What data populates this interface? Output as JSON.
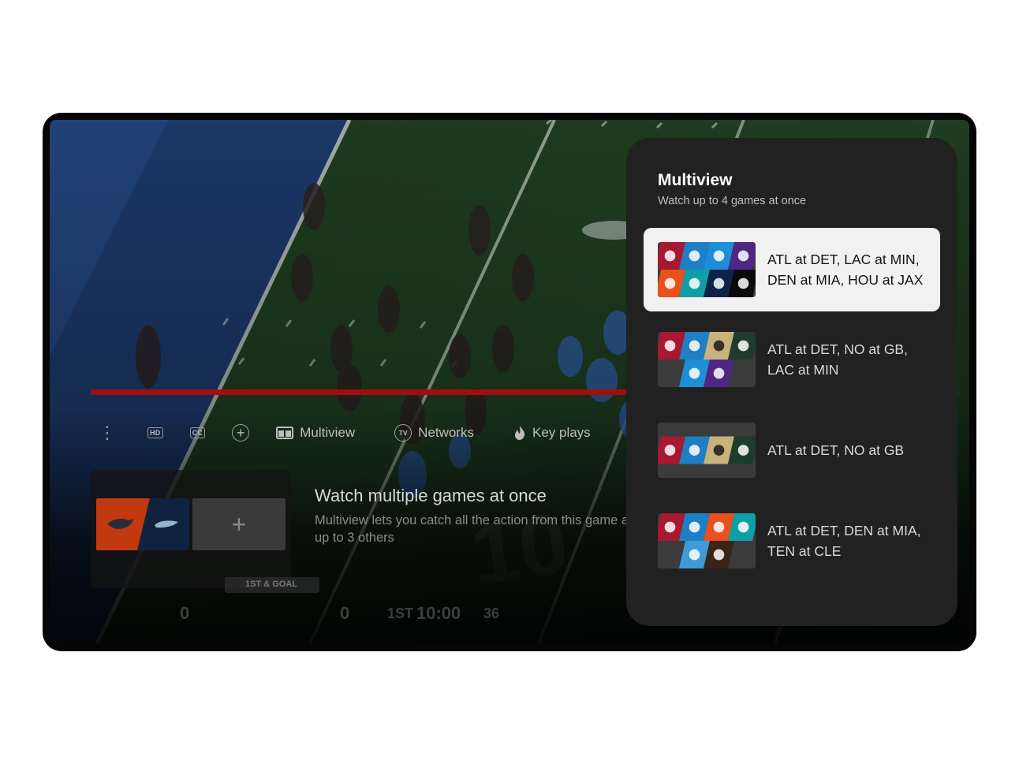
{
  "player": {
    "progress_fraction": 0.62,
    "controls": {
      "more_label": "⋮",
      "hd_label": "HD",
      "cc_label": "CC",
      "add_label": "+",
      "multiview_label": "Multiview",
      "networks_label": "Networks",
      "networks_icon_text": "TV",
      "keyplays_label": "Key plays"
    },
    "promo": {
      "title": "Watch multiple games at once",
      "description": "Multiview lets you catch all the action from this game and up to 3 others"
    },
    "add_tile_label": "+",
    "scoreboard": {
      "down_and_distance": "1ST & GOAL",
      "away_score": "0",
      "home_score": "0",
      "quarter": "1ST",
      "clock": "10:00",
      "play_clock": "36"
    }
  },
  "panel": {
    "title": "Multiview",
    "subtitle": "Watch up to 4 games at once",
    "options": [
      {
        "label": "ATL at DET, LAC at MIN, DEN at MIA, HOU at JAX",
        "teams": [
          "ATL",
          "DET",
          "LAC",
          "MIN",
          "DEN",
          "MIA",
          "HOU",
          "JAX"
        ],
        "selected": true
      },
      {
        "label": "ATL at DET, NO at GB, LAC at MIN",
        "teams": [
          "ATL",
          "DET",
          "NO",
          "GB",
          "LAC",
          "MIN"
        ],
        "selected": false
      },
      {
        "label": "ATL at DET, NO at GB",
        "teams": [
          "ATL",
          "DET",
          "NO",
          "GB"
        ],
        "selected": false
      },
      {
        "label": "ATL at DET, DEN at MIA, TEN at CLE",
        "teams": [
          "ATL",
          "DET",
          "DEN",
          "MIA",
          "TEN",
          "CLE"
        ],
        "selected": false
      }
    ]
  },
  "team_colors": {
    "ATL": "#a71930",
    "DET": "#1f7fc4",
    "LAC": "#1d8fd6",
    "MIN": "#4f2683",
    "DEN": "#e8501d",
    "MIA": "#0f9ea6",
    "HOU": "#0b2446",
    "JAX": "#0a0a0a",
    "NO": "#c9b27c",
    "GB": "#1f3b2e",
    "TEN": "#3f9ad8",
    "CLE": "#3a2418",
    "SEA": "#0f2340"
  },
  "team_icons": {
    "ATL": "falcon-icon",
    "DET": "lion-icon",
    "LAC": "bolt-icon",
    "MIN": "viking-icon",
    "DEN": "bronco-icon",
    "MIA": "dolphin-icon",
    "HOU": "bull-icon",
    "JAX": "jaguar-icon",
    "NO": "fleur-de-lis-icon",
    "GB": "g-logo-icon",
    "TEN": "titan-icon",
    "CLE": "helmet-icon"
  }
}
